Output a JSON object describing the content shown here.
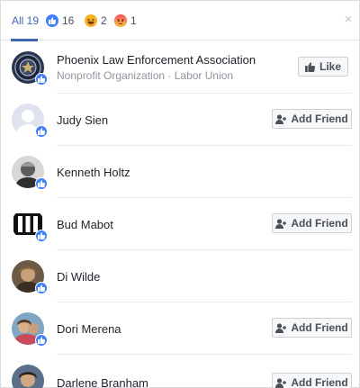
{
  "tabs": {
    "all_label": "All 19",
    "like_count": "16",
    "haha_count": "2",
    "angry_count": "1",
    "close_glyph": "×"
  },
  "accent_color": "#4267b2",
  "rows": [
    {
      "name": "Phoenix Law Enforcement Association",
      "subtitle": "Nonprofit Organization · Labor Union",
      "button": "Like",
      "avatar_icon": "police-badge-avatar"
    },
    {
      "name": "Judy Sien",
      "button": "Add Friend",
      "avatar_icon": "default-person-avatar"
    },
    {
      "name": "Kenneth Holtz",
      "avatar_icon": "photo-avatar"
    },
    {
      "name": "Bud Mabot",
      "button": "Add Friend",
      "avatar_icon": "bars-logo-avatar"
    },
    {
      "name": "Di Wilde",
      "avatar_icon": "photo-avatar"
    },
    {
      "name": "Dori Merena",
      "button": "Add Friend",
      "avatar_icon": "photo-avatar"
    },
    {
      "name": "Darlene Branham",
      "button": "Add Friend",
      "avatar_icon": "photo-avatar"
    }
  ]
}
